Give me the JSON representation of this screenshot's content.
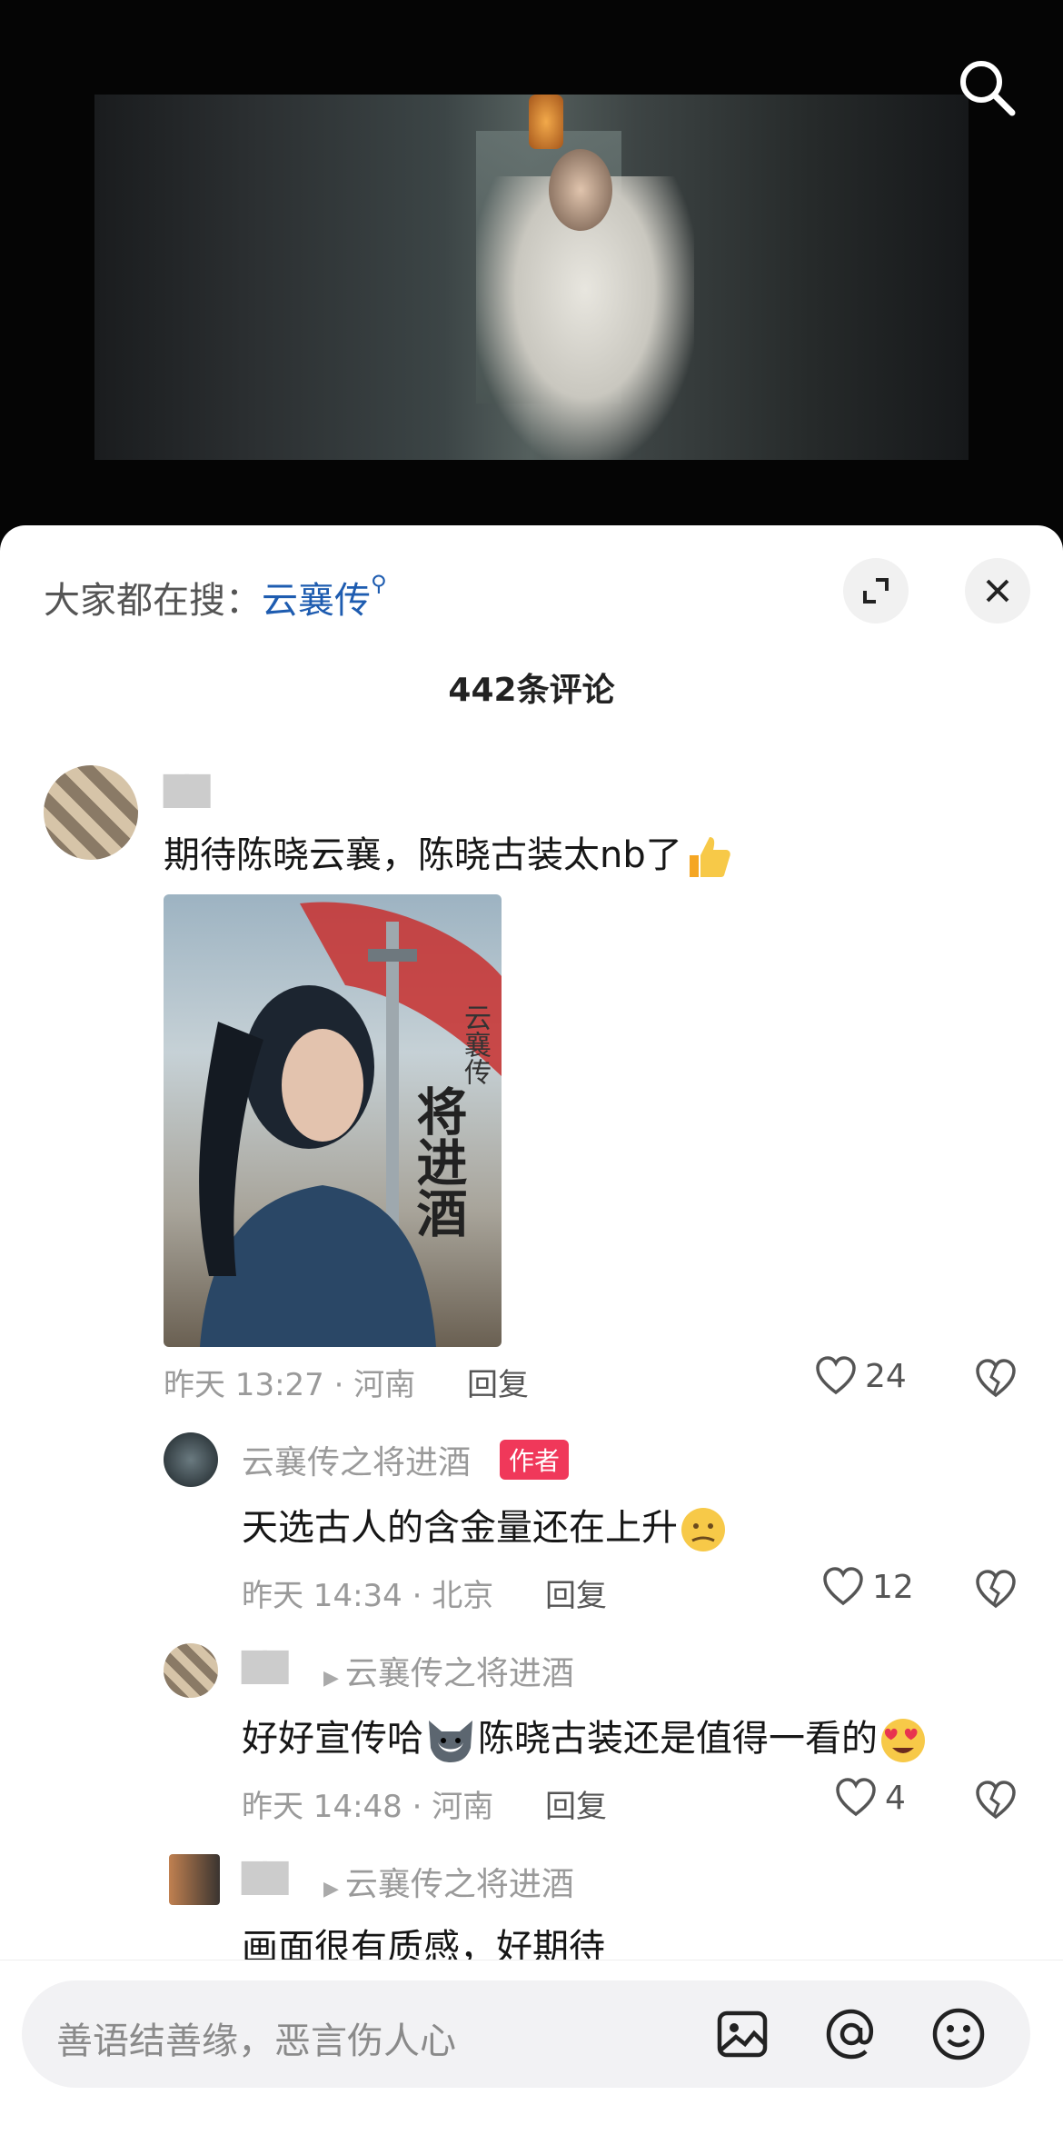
{
  "trending": {
    "prefix": "大家都在搜：",
    "keyword": "云襄传"
  },
  "comment_count": "442条评论",
  "comments": [
    {
      "username": "▇▇",
      "text": "期待陈晓云襄，陈晓古装太nb了",
      "time": "昨天 13:27 · 河南",
      "reply": "回复",
      "likes": "24"
    },
    {
      "username": "云襄传之将进酒",
      "badge": "作者",
      "text": "天选古人的含金量还在上升",
      "time": "昨天 14:34 · 北京",
      "reply": "回复",
      "likes": "12"
    },
    {
      "username": "▇▇",
      "reply_to": "云襄传之将进酒",
      "text_a": "好好宣传哈",
      "text_b": "陈晓古装还是值得一看的",
      "time": "昨天 14:48 · 河南",
      "reply": "回复",
      "likes": "4"
    },
    {
      "username": "▇▇",
      "reply_to": "云襄传之将进酒",
      "text": "画面很有质感，好期待"
    }
  ],
  "poster": {
    "title_vertical": "云襄传",
    "main_title": "将进酒"
  },
  "input": {
    "placeholder": "善语结善缘，恶言伤人心"
  },
  "colors": {
    "accent_link": "#1e5cb0",
    "badge": "#f0385a",
    "background": "#ffffff"
  },
  "icons": [
    "search-icon",
    "expand-icon",
    "close-icon",
    "heart-icon",
    "broken-heart-icon",
    "image-icon",
    "at-icon",
    "emoji-icon"
  ]
}
